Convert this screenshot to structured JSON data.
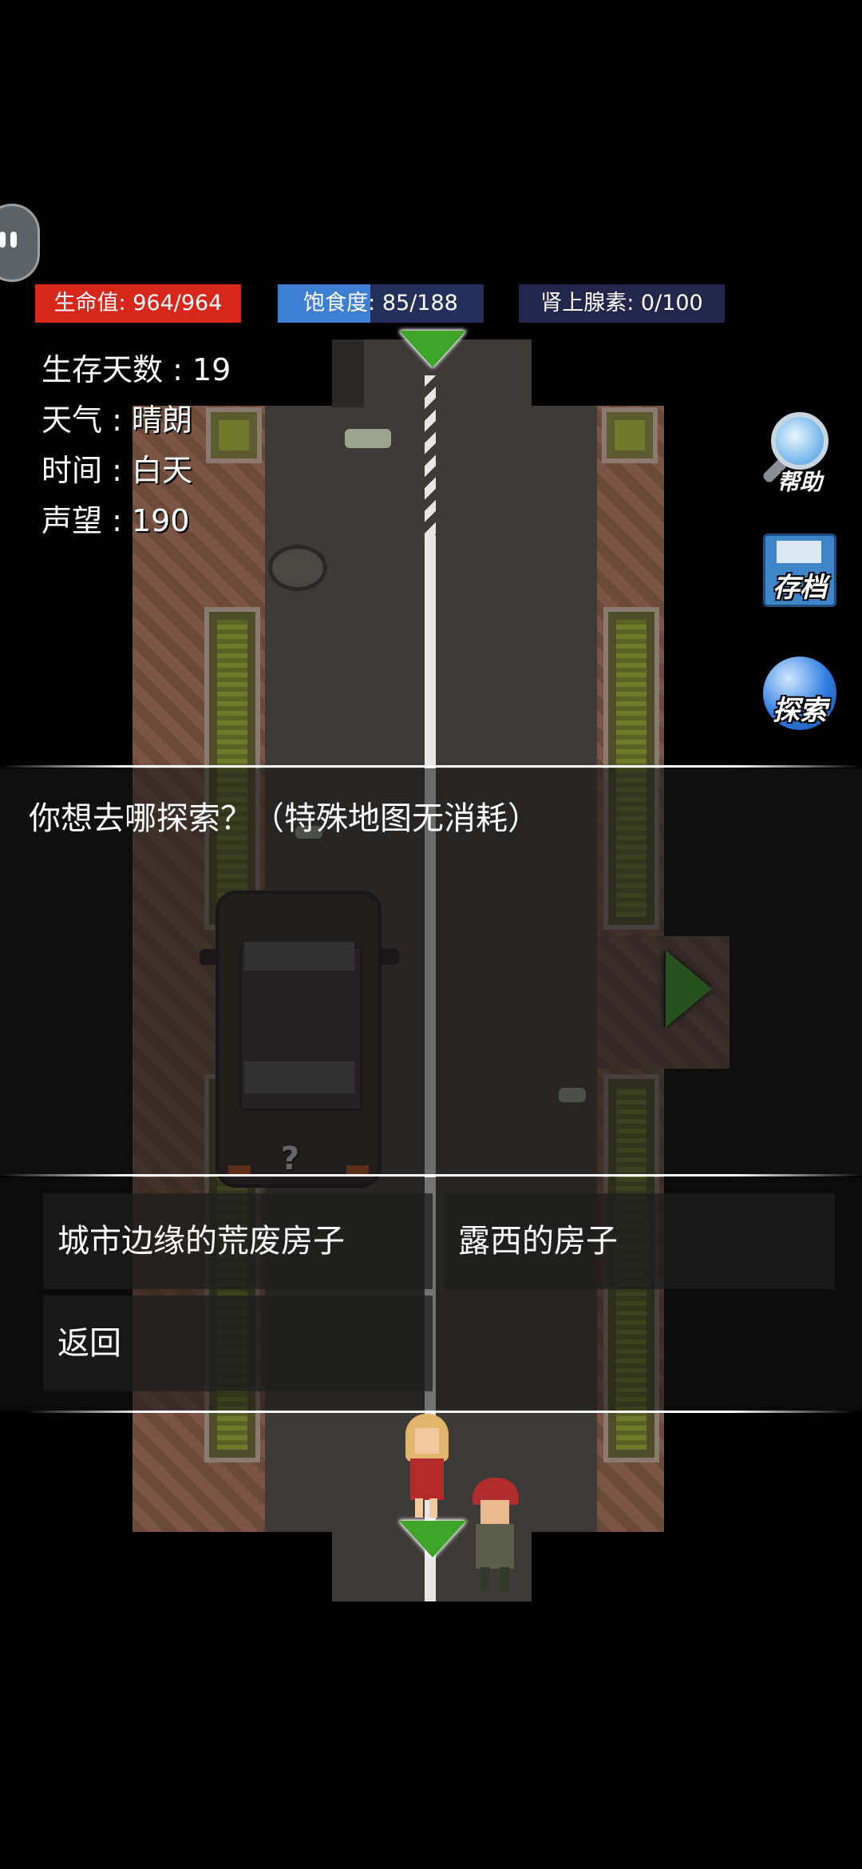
{
  "status_bars": {
    "health": {
      "label": "生命值: 964/964",
      "current": 964,
      "max": 964,
      "color": "#d6271a"
    },
    "satiety": {
      "label": "饱食度: 85/188",
      "current": 85,
      "max": 188,
      "color": "#3f7fd3"
    },
    "adrenaline": {
      "label": "肾上腺素: 0/100",
      "current": 0,
      "max": 100,
      "color": "#4a6fbf"
    }
  },
  "stats": {
    "days": "生存天数 : 19",
    "weather": "天气 : 晴朗",
    "time": "时间 : 白天",
    "reputation": "声望 : 190"
  },
  "side_buttons": {
    "help": "帮助",
    "save": "存档",
    "explore": "探索"
  },
  "dialog": {
    "prompt": "你想去哪探索？（特殊地图无消耗）",
    "options": [
      "城市边缘的荒废房子",
      "露西的房子"
    ],
    "back": "返回"
  },
  "map_marker": "?",
  "icons": [
    "assistant-bubble-icon",
    "magnifier-icon",
    "floppy-disk-icon",
    "globe-icon",
    "arrow-down-icon",
    "arrow-right-icon"
  ]
}
